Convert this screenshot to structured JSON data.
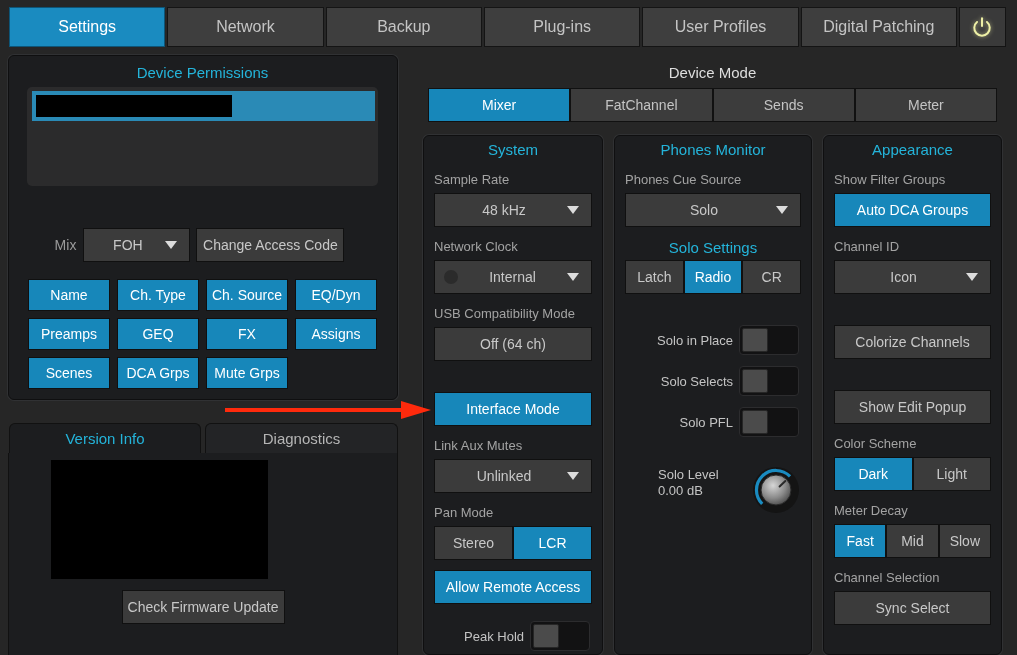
{
  "top_tabs": [
    {
      "label": "Settings",
      "selected": true
    },
    {
      "label": "Network",
      "selected": false
    },
    {
      "label": "Backup",
      "selected": false
    },
    {
      "label": "Plug-ins",
      "selected": false
    },
    {
      "label": "User Profiles",
      "selected": false
    },
    {
      "label": "Digital Patching",
      "selected": false
    }
  ],
  "power_button": {
    "on": true
  },
  "device_permissions": {
    "title": "Device Permissions",
    "list": [
      {
        "redacted": true,
        "selected": true
      }
    ],
    "mix": {
      "label": "Mix",
      "value": "FOH"
    },
    "change_access_code_button": "Change Access Code",
    "permissions": [
      {
        "label": "Name",
        "on": true
      },
      {
        "label": "Ch. Type",
        "on": true
      },
      {
        "label": "Ch. Source",
        "on": true
      },
      {
        "label": "EQ/Dyn",
        "on": true
      },
      {
        "label": "Preamps",
        "on": true
      },
      {
        "label": "GEQ",
        "on": true
      },
      {
        "label": "FX",
        "on": true
      },
      {
        "label": "Assigns",
        "on": true
      },
      {
        "label": "Scenes",
        "on": true
      },
      {
        "label": "DCA Grps",
        "on": true
      },
      {
        "label": "Mute Grps",
        "on": true
      }
    ]
  },
  "info_tabs": [
    {
      "label": "Version Info",
      "selected": true
    },
    {
      "label": "Diagnostics",
      "selected": false
    }
  ],
  "version_info": {
    "redacted": true,
    "button": "Check Firmware Update"
  },
  "device_mode": {
    "title": "Device Mode",
    "tabs": [
      {
        "label": "Mixer",
        "selected": true
      },
      {
        "label": "FatChannel",
        "selected": false
      },
      {
        "label": "Sends",
        "selected": false
      },
      {
        "label": "Meter",
        "selected": false
      }
    ]
  },
  "columns": [
    {
      "title": "System",
      "rows": [
        {
          "label": "Sample Rate",
          "controls": [
            {
              "kind": "dropdown",
              "value": "48 kHz"
            }
          ]
        },
        {
          "label": "Network Clock",
          "controls": [
            {
              "kind": "dropdown",
              "value": "Internal",
              "indicator_on": false
            }
          ]
        },
        {
          "label": "USB Compatibility Mode",
          "controls": [
            {
              "kind": "button",
              "text": "Off (64 ch)",
              "on": false
            }
          ]
        },
        {
          "controls": [
            {
              "kind": "button",
              "text": "Interface Mode",
              "on": true
            }
          ]
        },
        {
          "label": "Link Aux Mutes",
          "controls": [
            {
              "kind": "dropdown",
              "value": "Unlinked"
            }
          ]
        },
        {
          "label": "Pan Mode",
          "controls": [
            {
              "kind": "segmented",
              "options": [
                {
                  "label": "Stereo",
                  "selected": false
                },
                {
                  "label": "LCR",
                  "selected": true
                }
              ]
            },
            {
              "kind": "button",
              "text": "Allow Remote Access",
              "on": true
            },
            {
              "kind": "toggle",
              "label": "Peak Hold",
              "on": false
            }
          ]
        }
      ]
    },
    {
      "title": "Phones Monitor",
      "rows": [
        {
          "label": "Phones Cue Source",
          "controls": [
            {
              "kind": "dropdown",
              "value": "Solo"
            }
          ]
        },
        {
          "subtitle": "Solo Settings",
          "controls": [
            {
              "kind": "segmented",
              "options": [
                {
                  "label": "Latch",
                  "selected": false
                },
                {
                  "label": "Radio",
                  "selected": true
                },
                {
                  "label": "CR",
                  "selected": false
                }
              ]
            }
          ]
        },
        {
          "controls": [
            {
              "kind": "toggle",
              "label": "Solo in Place",
              "on": false
            },
            {
              "kind": "toggle",
              "label": "Solo Selects",
              "on": false
            },
            {
              "kind": "toggle",
              "label": "Solo PFL",
              "on": false
            },
            {
              "kind": "knob",
              "label": "Solo Level",
              "reading": "0.00 dB",
              "level": 0.67
            }
          ]
        }
      ]
    },
    {
      "title": "Appearance",
      "rows": [
        {
          "label": "Show Filter Groups",
          "controls": [
            {
              "kind": "button",
              "text": "Auto DCA Groups",
              "on": true
            }
          ]
        },
        {
          "label": "Channel ID",
          "controls": [
            {
              "kind": "dropdown",
              "value": "Icon"
            }
          ]
        },
        {
          "controls": [
            {
              "kind": "button",
              "text": "Colorize Channels",
              "on": false
            }
          ]
        },
        {
          "controls": [
            {
              "kind": "button",
              "text": "Show Edit Popup",
              "on": false
            }
          ]
        },
        {
          "label": "Color Scheme",
          "controls": [
            {
              "kind": "segmented",
              "options": [
                {
                  "label": "Dark",
                  "selected": true
                },
                {
                  "label": "Light",
                  "selected": false
                }
              ]
            }
          ]
        },
        {
          "label": "Meter Decay",
          "controls": [
            {
              "kind": "segmented",
              "options": [
                {
                  "label": "Fast",
                  "selected": true
                },
                {
                  "label": "Mid",
                  "selected": false
                },
                {
                  "label": "Slow",
                  "selected": false
                }
              ]
            }
          ]
        },
        {
          "label": "Channel Selection",
          "controls": [
            {
              "kind": "button",
              "text": "Sync Select",
              "on": false
            }
          ]
        }
      ]
    }
  ],
  "annotations": [
    {
      "kind": "arrow"
    }
  ]
}
